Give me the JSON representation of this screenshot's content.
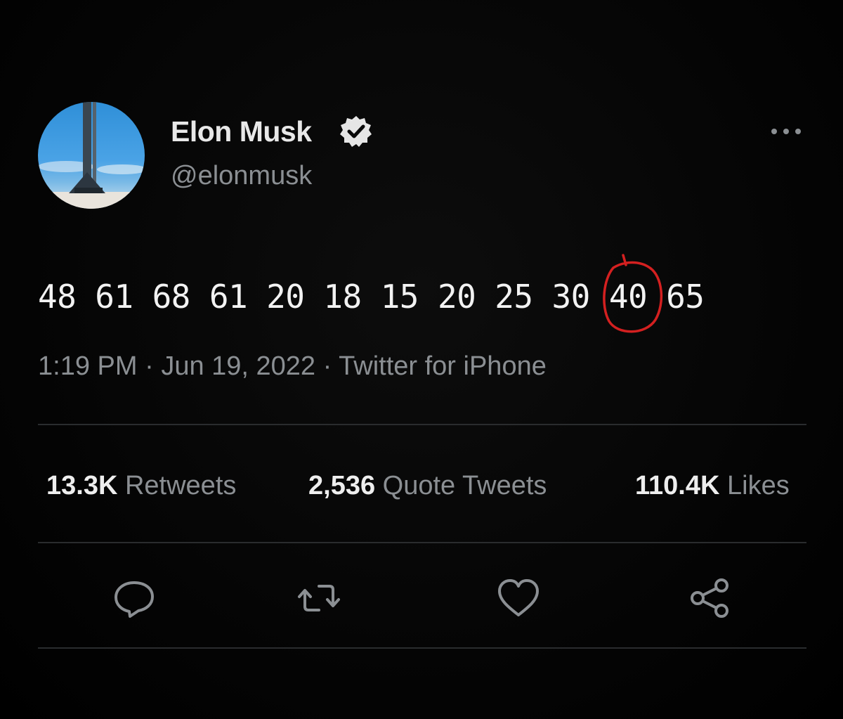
{
  "author": {
    "display_name": "Elon Musk",
    "handle": "@elonmusk",
    "verified_icon": "verified-badge-icon",
    "avatar": "rocket-on-launchpad-avatar"
  },
  "menu": {
    "icon": "more-dots-icon"
  },
  "tweet": {
    "numbers_before": "48 61 68 61 20 18 15 20 25 30 ",
    "circled_number": "40",
    "numbers_after": " 65",
    "circle_color": "#d42020"
  },
  "meta": {
    "time": "1:19 PM",
    "sep1": " · ",
    "date": "Jun 19, 2022",
    "sep2": " · ",
    "source": "Twitter for iPhone"
  },
  "stats": [
    {
      "count": "13.3K",
      "label": "Retweets"
    },
    {
      "count": "2,536",
      "label": "Quote Tweets"
    },
    {
      "count": "110.4K",
      "label": "Likes"
    }
  ],
  "actions": [
    {
      "icon": "reply-icon"
    },
    {
      "icon": "retweet-icon"
    },
    {
      "icon": "like-heart-icon"
    },
    {
      "icon": "share-icon"
    }
  ],
  "colors": {
    "background": "#000000",
    "primary_text": "#e7e9ea",
    "secondary_text": "#8b8f93",
    "divider": "#2a2c2e",
    "annotation_red": "#d42020"
  }
}
